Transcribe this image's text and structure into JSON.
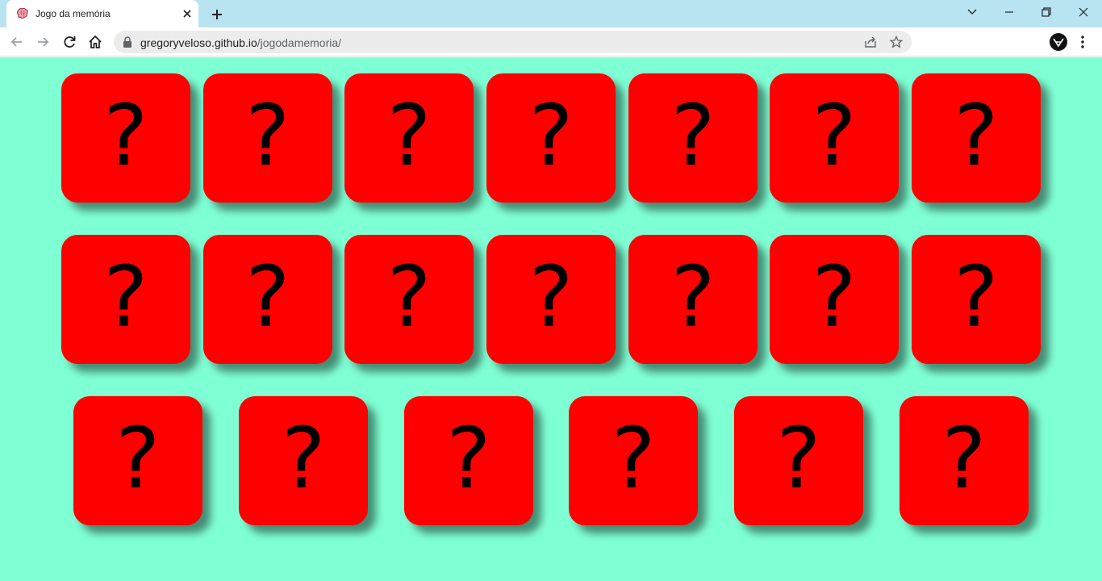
{
  "browser": {
    "tab_title": "Jogo da memória",
    "url_host": "gregoryveloso.github.io",
    "url_path": "/jogodamemoria/",
    "icons": {
      "favicon": "brain-icon",
      "close": "close-icon",
      "new_tab": "plus-icon",
      "back": "arrow-left-icon",
      "forward": "arrow-right-icon",
      "reload": "reload-icon",
      "home": "home-icon",
      "lock": "lock-icon",
      "share": "share-icon",
      "bookmark": "star-icon",
      "profile": "avatar",
      "menu": "kebab-menu-icon"
    },
    "colors": {
      "tabstrip": "#b8e4f2",
      "omnibox": "#ececec"
    }
  },
  "game": {
    "background_color": "#7fffd4",
    "card_color": "#ff0000",
    "card_face_symbol": "?",
    "rows": [
      {
        "cards": [
          "?",
          "?",
          "?",
          "?",
          "?",
          "?",
          "?"
        ]
      },
      {
        "cards": [
          "?",
          "?",
          "?",
          "?",
          "?",
          "?",
          "?"
        ]
      },
      {
        "cards": [
          "?",
          "?",
          "?",
          "?",
          "?",
          "?"
        ]
      }
    ]
  }
}
